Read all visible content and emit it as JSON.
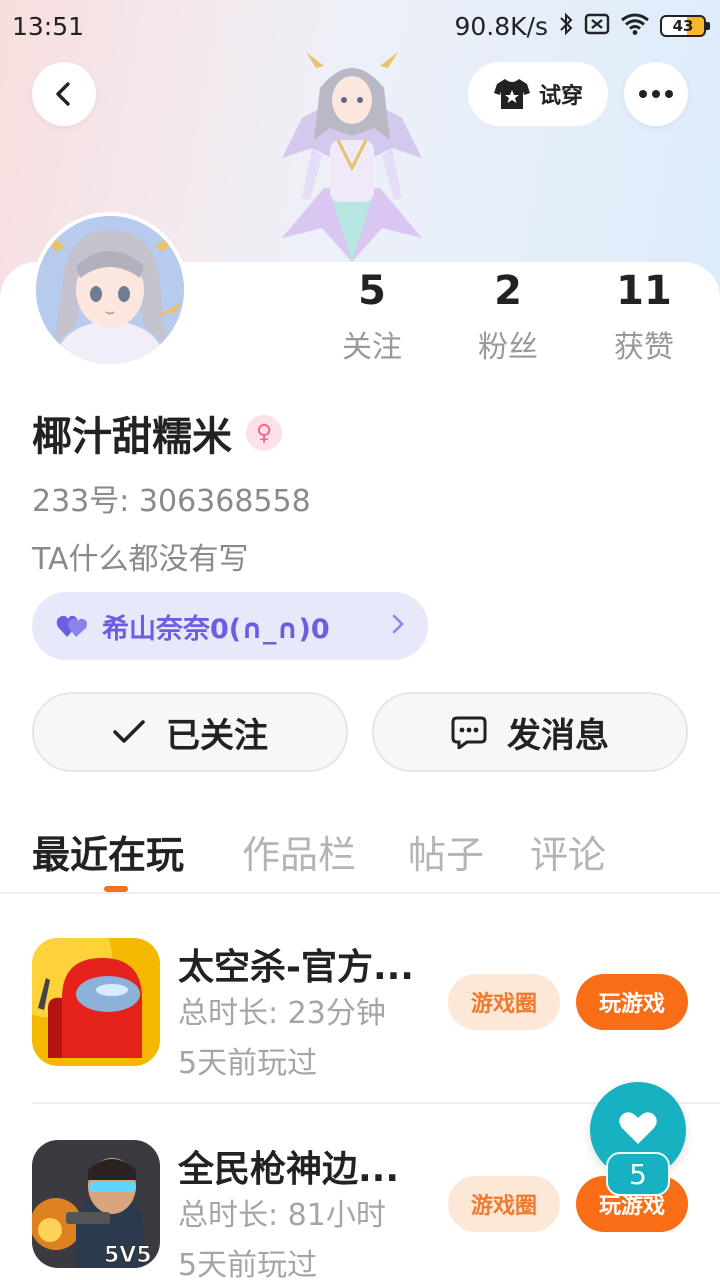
{
  "status_bar": {
    "time": "13:51",
    "net_speed": "90.8K/s",
    "battery": "43"
  },
  "header": {
    "tryon_label": "试穿"
  },
  "profile": {
    "stats": [
      {
        "value": "5",
        "label": "关注"
      },
      {
        "value": "2",
        "label": "粉丝"
      },
      {
        "value": "11",
        "label": "获赞"
      }
    ],
    "username": "椰汁甜糯米",
    "gender_symbol": "♀",
    "uid": "233号: 306368558",
    "bio": "TA什么都没有写",
    "cp_name": "希山奈奈0(∩_∩)0"
  },
  "actions": {
    "follow_label": "已关注",
    "message_label": "发消息"
  },
  "tabs": [
    {
      "label": "最近在玩"
    },
    {
      "label": "作品栏"
    },
    {
      "label": "帖子"
    },
    {
      "label": "评论"
    }
  ],
  "games": [
    {
      "name": "太空杀-官方...",
      "playtime": "总时长: 23分钟",
      "last_played": "5天前玩过",
      "circle_label": "游戏圈",
      "play_label": "玩游戏"
    },
    {
      "name": "全民枪神边...",
      "playtime": "总时长: 81小时",
      "last_played": "5天前玩过",
      "circle_label": "游戏圈",
      "play_label": "玩游戏",
      "icon_text": "5V5"
    }
  ],
  "like_fab": {
    "count": "5"
  },
  "colors": {
    "accent_orange": "#f96d16",
    "cp_purple": "#6a5fe0",
    "fab_teal": "#17b1c1"
  }
}
